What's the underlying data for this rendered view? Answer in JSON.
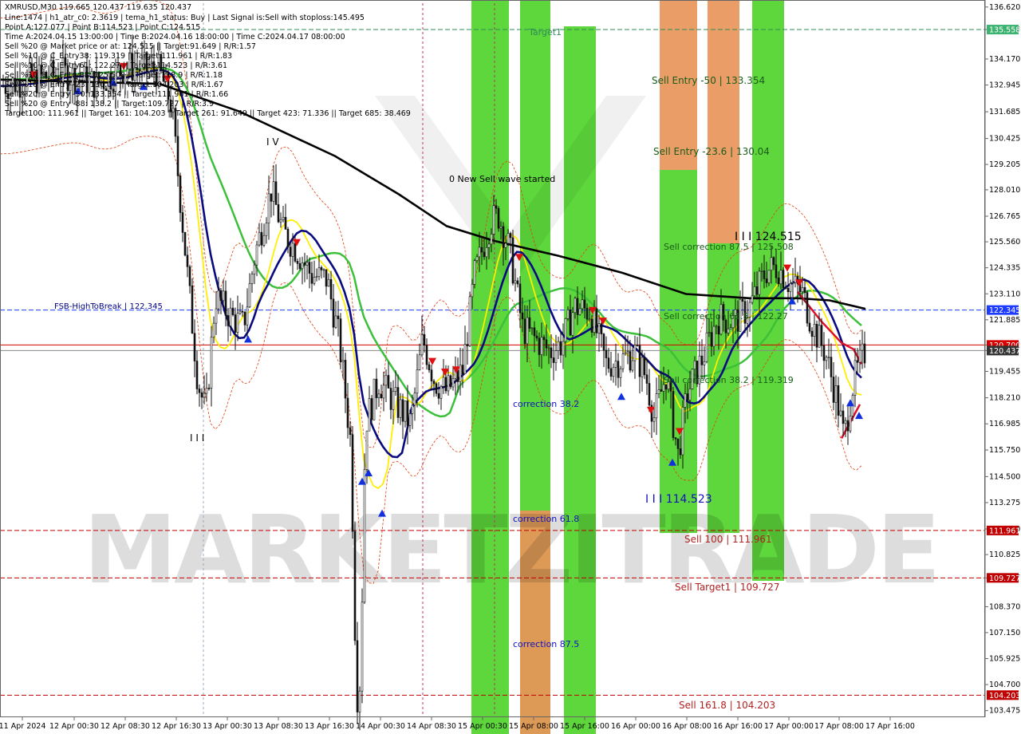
{
  "header": {
    "symbol_line": "XMRUSD,M30  119.665 120.437 119.635 120.437",
    "lines": [
      "Line:1474 | h1_atr_c0: 2.3619 | tema_h1_status: Buy | Last Signal is:Sell with stoploss:145.495",
      "Point A:127.077 | Point B:114.523 | Point C:124.515",
      "Time A:2024.04.15 13:00:00 | Time B:2024.04.16 18:00:00 | Time C:2024.04.17 08:00:00",
      "Sell %20 @ Market price or at: 124.515 || Target:91.649 | R/R:1.57",
      "Sell %10 @ C_Entry38: 119.319 || Target:111.961 | R/R:1.83",
      "Sell %10 @ C_Entry61: 122.27 || Target:114.523 | R/R:3.61",
      "Sell %10 @ C_Entry88: 125.508 || Target:118.9 | R/R:1.18",
      "Sell %10 @ Entry -23: 130.04 || Target:104.203 | R/R:1.67",
      "Sell %20 @ Entry -50: 133.354 || Target:111.961 | R/R:1.66",
      "Sell %20 @ Entry -88: 138.2 || Target:109.727 | R/R:3.9",
      "Target100: 111.961 || Target 161: 104.203 || Target 261: 91.649 || Target 423: 71.336 || Target 685: 38.469"
    ]
  },
  "chart_data": {
    "type": "candlestick",
    "symbol": "XMRUSD",
    "timeframe": "M30",
    "y_ticks": [
      "136.620",
      "135.558",
      "134.170",
      "132.945",
      "131.685",
      "130.425",
      "129.205",
      "128.010",
      "126.765",
      "125.560",
      "124.335",
      "123.110",
      "121.885",
      "120.700",
      "120.437",
      "119.455",
      "118.210",
      "116.985",
      "115.750",
      "114.500",
      "113.275",
      "112.030",
      "110.825",
      "109.727",
      "108.370",
      "107.150",
      "105.925",
      "104.700",
      "103.475"
    ],
    "y_range": [
      103.2,
      136.8
    ],
    "x_ticks": [
      "11 Apr 2024",
      "12 Apr 00:30",
      "12 Apr 08:30",
      "12 Apr 16:30",
      "13 Apr 00:30",
      "13 Apr 08:30",
      "13 Apr 16:30",
      "14 Apr 00:30",
      "14 Apr 08:30",
      "15 Apr 00:30",
      "15 Apr 08:00",
      "15 Apr 16:00",
      "16 Apr 00:00",
      "16 Apr 08:00",
      "16 Apr 16:00",
      "17 Apr 00:00",
      "17 Apr 08:00",
      "17 Apr 16:00"
    ],
    "price_tags": [
      {
        "label": "135.558",
        "value": 135.558,
        "color": "#3cb371"
      },
      {
        "label": "122.345",
        "value": 122.345,
        "color": "#1e3cff"
      },
      {
        "label": "120.700",
        "value": 120.7,
        "color": "#d60000"
      },
      {
        "label": "120.437",
        "value": 120.437,
        "color": "#333333"
      },
      {
        "label": "111.961",
        "value": 111.961,
        "color": "#c00000"
      },
      {
        "label": "109.727",
        "value": 109.727,
        "color": "#c00000"
      },
      {
        "label": "104.203",
        "value": 104.203,
        "color": "#c00000"
      }
    ],
    "levels": [
      {
        "value": 135.558,
        "color": "#2e8b57",
        "style": "dashed"
      },
      {
        "value": 122.345,
        "color": "#1e3cff",
        "style": "dashed"
      },
      {
        "value": 120.7,
        "color": "#d60000",
        "style": "solid"
      },
      {
        "value": 120.437,
        "color": "#888888",
        "style": "solid"
      },
      {
        "value": 111.961,
        "color": "#c00000",
        "style": "dashed"
      },
      {
        "value": 109.727,
        "color": "#c00000",
        "style": "dashed"
      },
      {
        "value": 104.203,
        "color": "#c00000",
        "style": "dashed"
      }
    ],
    "annotations": [
      {
        "text": "Target1",
        "color": "#2e8b57"
      },
      {
        "text": "Sell Entry -50 | 133.354",
        "color": "#1a5c1a"
      },
      {
        "text": "Sell Entry -23.6 | 130.04",
        "color": "#1a5c1a"
      },
      {
        "text": "0 New Sell wave started",
        "color": "#000000"
      },
      {
        "text": "I I I 124.515",
        "color": "#000000"
      },
      {
        "text": "Sell correction 87.5 | 125.508",
        "color": "#1a5c1a"
      },
      {
        "text": "Sell correction 61.8 | 122.27",
        "color": "#1a5c1a"
      },
      {
        "text": "Sell correction 38.2 | 119.319",
        "color": "#1a5c1a"
      },
      {
        "text": "FSB-HighToBreak | 122.345",
        "color": "#000080"
      },
      {
        "text": "correction 38.2",
        "color": "#1010c0"
      },
      {
        "text": "correction 61.8",
        "color": "#1010c0"
      },
      {
        "text": "correction 87.5",
        "color": "#1010c0"
      },
      {
        "text": "I I I 114.523",
        "color": "#1010c0"
      },
      {
        "text": "Sell 100 | 111.961",
        "color": "#b22222"
      },
      {
        "text": "Sell Target1 | 109.727",
        "color": "#b22222"
      },
      {
        "text": "Sell 161.8 | 104.203",
        "color": "#b22222"
      },
      {
        "text": "I V",
        "color": "#000000"
      },
      {
        "text": "I I I",
        "color": "#000000"
      }
    ],
    "watermark": "MARKETZITRADE"
  }
}
